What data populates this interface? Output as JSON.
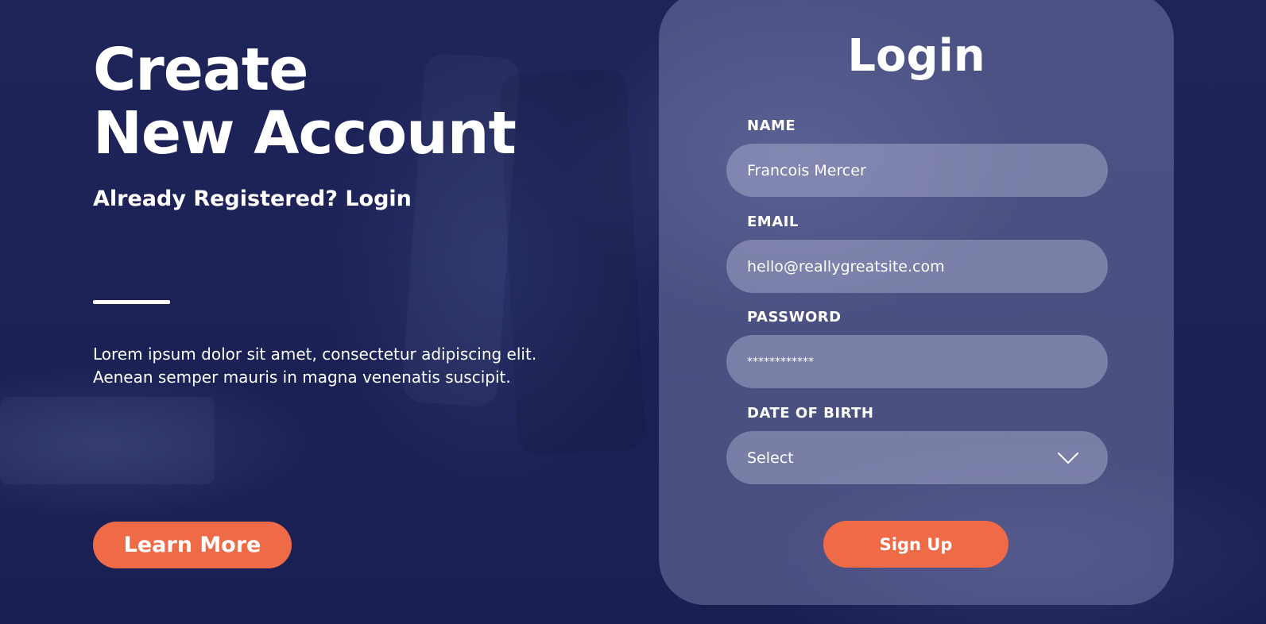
{
  "left": {
    "title_line1": "Create",
    "title_line2": "New Account",
    "subtitle": "Already Registered? Login",
    "description_line1": "Lorem ipsum dolor sit amet, consectetur adipiscing elit.",
    "description_line2": "Aenean semper mauris in magna venenatis suscipit.",
    "learn_more_label": "Learn More"
  },
  "form": {
    "title": "Login",
    "fields": [
      {
        "label": "NAME",
        "value": "Francois Mercer"
      },
      {
        "label": "EMAIL",
        "value": "hello@reallygreatsite.com"
      },
      {
        "label": "PASSWORD",
        "value": "************"
      },
      {
        "label": "DATE OF BIRTH",
        "value": "Select",
        "icon": "chevron-down-icon"
      }
    ],
    "submit_label": "Sign Up"
  },
  "colors": {
    "background": "#1c2157",
    "accent": "#ef6a47",
    "card": "#8c92be"
  }
}
